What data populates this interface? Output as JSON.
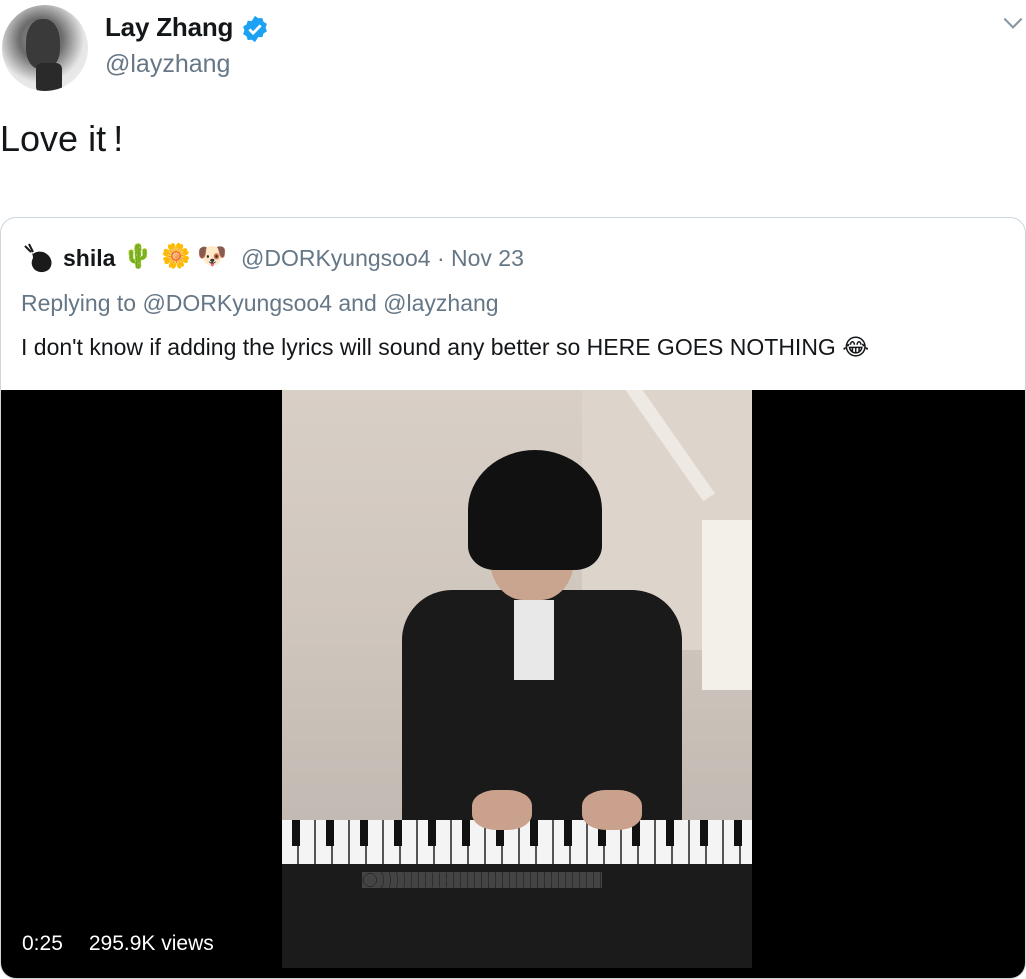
{
  "author": {
    "display_name": "Lay Zhang",
    "handle": "@layzhang",
    "verified_icon": "verified-badge-icon"
  },
  "tweet": {
    "text": "Love it !"
  },
  "quoted_tweet": {
    "display_name": "shila",
    "emojis": [
      "🌵",
      "🌼",
      "🐶"
    ],
    "handle_date": "@DORKyungsoo4 · Nov 23",
    "replying_to": "Replying to @DORKyungsoo4 and @layzhang",
    "text": "I don't know if adding the lyrics will sound any better so HERE GOES NOTHING",
    "text_emoji": "😂"
  },
  "video": {
    "time": "0:25",
    "views": "295.9K views"
  },
  "colors": {
    "verified": "#1da1f2",
    "secondary_text": "#657786",
    "border": "#ccd6dd"
  }
}
